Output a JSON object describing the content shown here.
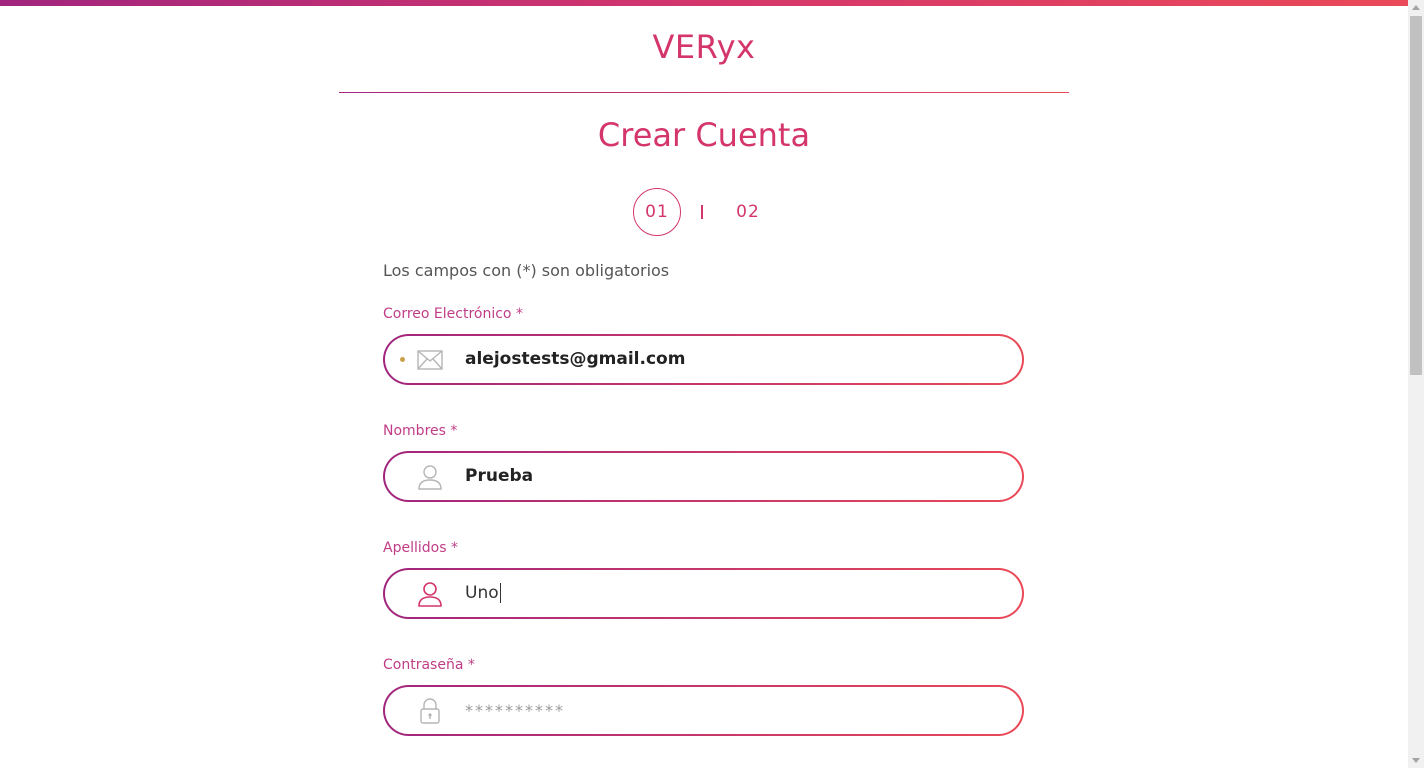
{
  "brand": {
    "logo_text": "VERyx"
  },
  "page": {
    "title": "Crear Cuenta",
    "steps": [
      {
        "label": "01",
        "active": true
      },
      {
        "label": "02",
        "active": false
      }
    ],
    "required_note": "Los campos con (*) son obligatorios"
  },
  "form": {
    "email": {
      "label": "Correo Electrónico *",
      "value": "alejostests@gmail.com",
      "icon": "envelope-icon"
    },
    "first_name": {
      "label": "Nombres *",
      "value": "Prueba",
      "icon": "user-icon"
    },
    "last_name": {
      "label": "Apellidos *",
      "value": "Uno",
      "icon": "user-icon",
      "focused": true
    },
    "password": {
      "label": "Contraseña *",
      "placeholder": "**********",
      "icon": "lock-icon"
    }
  },
  "colors": {
    "brand": "#d4366c",
    "gradient_start": "#a1257e",
    "gradient_end": "#ea4957",
    "label": "#c03d86"
  }
}
